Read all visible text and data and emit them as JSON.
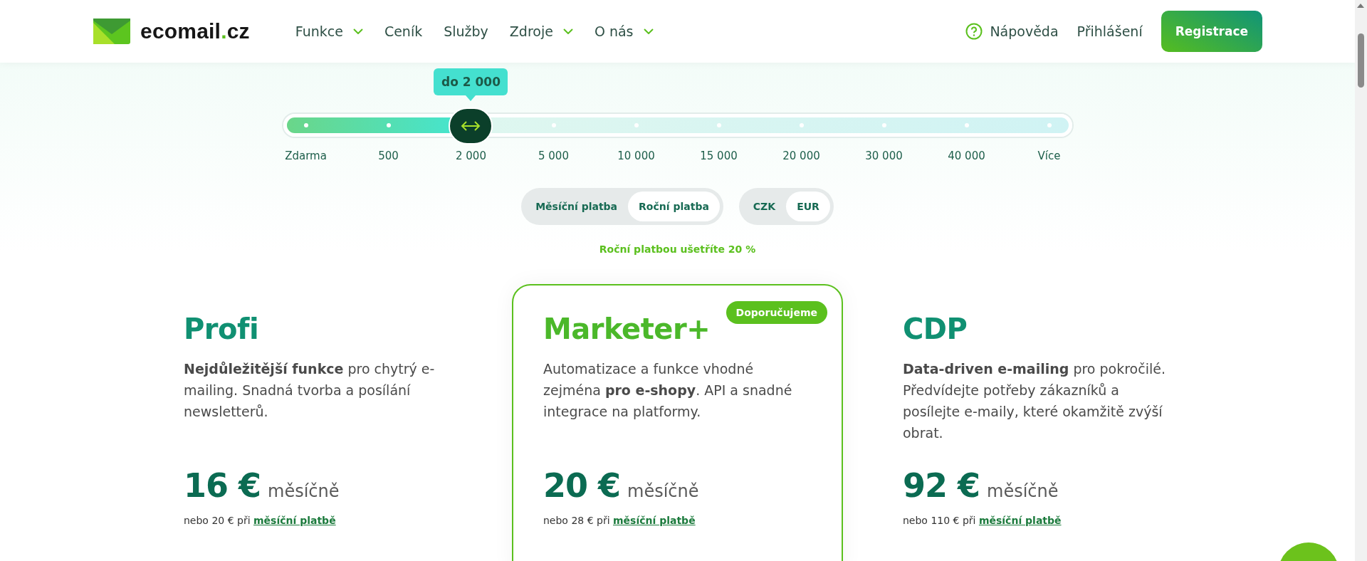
{
  "header": {
    "logo": [
      {
        "text": "ecomail",
        "accent": false
      },
      {
        "text": ".",
        "accent": true
      },
      {
        "text": "cz",
        "accent": false
      }
    ],
    "nav": [
      {
        "label": "Funkce",
        "dropdown": true
      },
      {
        "label": "Ceník",
        "dropdown": false
      },
      {
        "label": "Služby",
        "dropdown": false
      },
      {
        "label": "Zdroje",
        "dropdown": true
      },
      {
        "label": "O nás",
        "dropdown": true
      }
    ],
    "help": "Nápověda",
    "login": "Přihlášení",
    "register": "Registrace"
  },
  "slider": {
    "tooltip": "do 2 000",
    "level": 0.2222,
    "stops": [
      "Zdarma",
      "500",
      "2 000",
      "5 000",
      "10 000",
      "15 000",
      "20 000",
      "30 000",
      "40 000",
      "Více"
    ]
  },
  "billing": [
    {
      "label": "Měsíční platba",
      "selected": false
    },
    {
      "label": "Roční platba",
      "selected": true
    }
  ],
  "currency": [
    {
      "label": "CZK",
      "selected": false
    },
    {
      "label": "EUR",
      "selected": true
    }
  ],
  "savings_note": "Roční platbou ušetříte 20 %",
  "plans": [
    {
      "name": "Profi",
      "featured": false,
      "description": "**Nejdůležitější funkce** pro chytrý e-mailing. Snadná tvorba a posílání newsletterů.",
      "price": "16 €",
      "period": "měsíčně",
      "note": "nebo 20 € při",
      "note_link": "měsíční platbě"
    },
    {
      "name": "Marketer+",
      "featured": true,
      "badge": "Doporučujeme",
      "description": "Automatizace a funkce vhodné zejména **pro e-shopy**. API a snadné integrace na platformy.",
      "price": "20 €",
      "period": "měsíčně",
      "note": "nebo 28 € při",
      "note_link": "měsíční platbě"
    },
    {
      "name": "CDP",
      "featured": false,
      "description": "**Data-driven e-mailing** pro pokročilé. Předvídejte potřeby zákazníků a posílejte e-maily, které okamžitě zvýší obrat.",
      "price": "92 €",
      "period": "měsíčně",
      "note": "nebo 110 € při",
      "note_link": "měsíční platbě"
    }
  ]
}
